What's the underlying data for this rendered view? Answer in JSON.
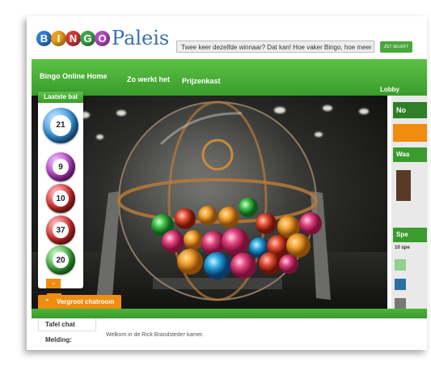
{
  "logo": {
    "letters": [
      "B",
      "I",
      "N",
      "G",
      "O"
    ],
    "word": "Paleis",
    "letter_colors": [
      "#2f7fd6",
      "#e9a11c",
      "#d33a3a",
      "#3fa64a",
      "#b44cc3"
    ]
  },
  "promo": {
    "text": "Twee keer dezelfde winnaar? Dat kan! Hoe vaker Bingo, hoe meer kans!",
    "button": "ZET SELEKT"
  },
  "nav": {
    "items": [
      "Bingo Online Home",
      "Zo werkt het",
      "Prijzenkast"
    ],
    "lobby": "Lobby"
  },
  "last_ball": {
    "title": "Laatste bal",
    "balls": [
      {
        "number": "21",
        "color": "#2f8ed8"
      },
      {
        "number": "9",
        "color": "#b23cc4"
      },
      {
        "number": "10",
        "color": "#d52b2b"
      },
      {
        "number": "37",
        "color": "#d52b2b"
      },
      {
        "number": "20",
        "color": "#3da63a"
      }
    ],
    "down_arrow": "⌄",
    "up_arrow": "⌃"
  },
  "chat": {
    "toggle": "Vergroot chatroom",
    "tab": "Tafel chat",
    "notice_label": "Melding:",
    "notice_text": "Welkom in de Rick Brandsteder kamer."
  },
  "sidebar": {
    "top": "No",
    "mid": "Waa",
    "spe": "Spe",
    "count": "10 spe"
  },
  "colors": {
    "green": "#3a9c2c",
    "orange": "#f08c10",
    "dark": "#1a1a18"
  }
}
